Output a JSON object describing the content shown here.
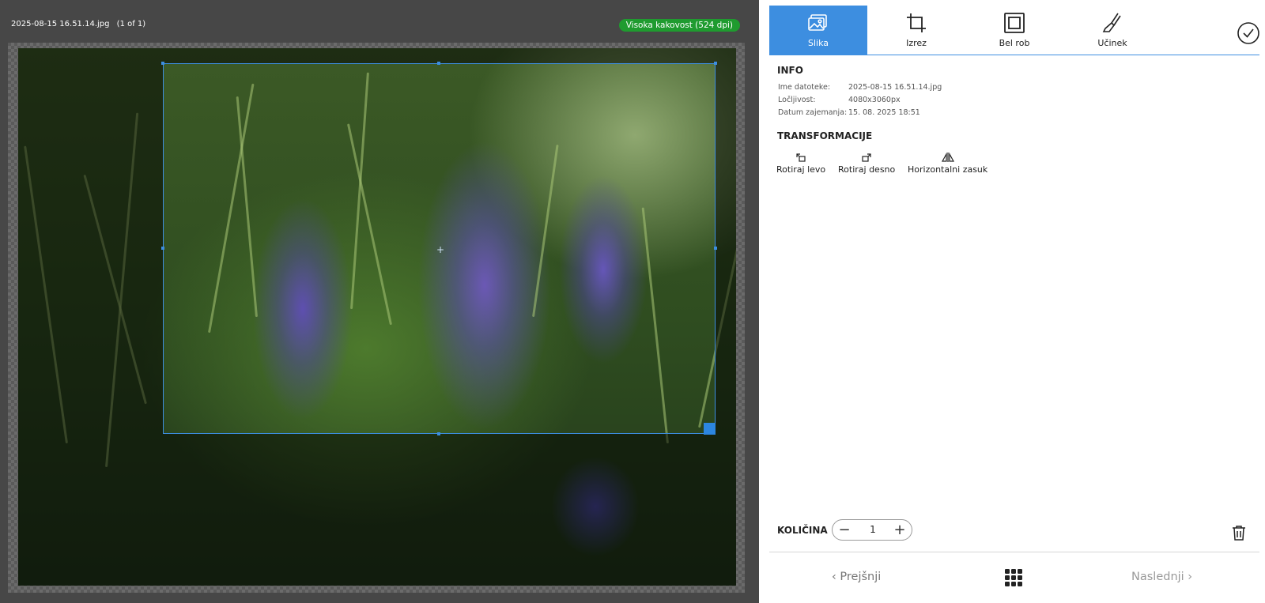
{
  "editor": {
    "file_name": "2025-08-15 16.51.14.jpg",
    "file_count": "(1 of 1)",
    "quality_badge": "Visoka kakovost (524 dpi)",
    "colors": {
      "accent": "#3d8ee0",
      "badge": "#1f9b2f",
      "canvas": "#474747"
    }
  },
  "tabs": [
    {
      "label": "Slika",
      "icon": "image-icon",
      "active": true
    },
    {
      "label": "Izrez",
      "icon": "crop-icon",
      "active": false
    },
    {
      "label": "Bel rob",
      "icon": "white-border-icon",
      "active": false
    },
    {
      "label": "Učinek",
      "icon": "brush-icon",
      "active": false
    }
  ],
  "info": {
    "title": "INFO",
    "rows": [
      {
        "key": "Ime datoteke:",
        "value": "2025-08-15 16.51.14.jpg"
      },
      {
        "key": "Ločljivost:",
        "value": "4080x3060px"
      },
      {
        "key": "Datum zajemanja:",
        "value": "15. 08. 2025 18:51"
      }
    ]
  },
  "transform": {
    "title": "TRANSFORMACIJE",
    "buttons": [
      {
        "label": "Rotiraj levo",
        "icon": "rotate-left-icon"
      },
      {
        "label": "Rotiraj desno",
        "icon": "rotate-right-icon"
      },
      {
        "label": "Horizontalni zasuk",
        "icon": "flip-horizontal-icon"
      }
    ]
  },
  "quantity": {
    "label": "KOLIČINA",
    "value": "1"
  },
  "nav": {
    "prev": "Prejšnji",
    "next": "Naslednji"
  }
}
